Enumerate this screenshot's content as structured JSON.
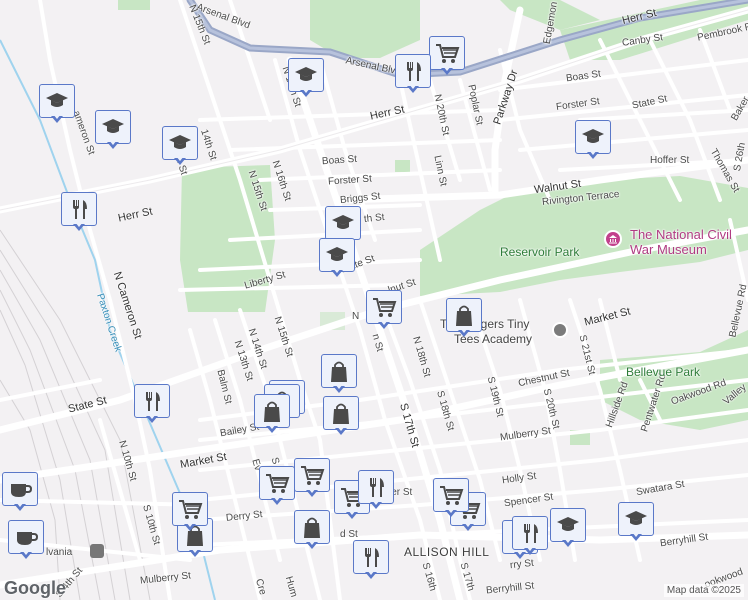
{
  "map": {
    "streets": {
      "arsenal_blvd": "Arsenal Blvd",
      "herr_st_top": "Herr St",
      "herr_st_mid": "Herr St",
      "herr_st_left": "Herr St",
      "canby_st": "Canby St",
      "pembrook_rd": "Pembrook R",
      "boas_st_right": "Boas St",
      "boas_st_left": "Boas St",
      "forster_st_right": "Forster St",
      "forster_st_left": "Forster St",
      "state_st_right": "State St",
      "state_st_mid": "State St",
      "state_st_left": "State St",
      "baker": "Baker",
      "hoffer_st": "Hoffer St",
      "thomas_st": "Thomas St",
      "s_26th": "S 26th",
      "walnut_st": "Walnut St",
      "rivington_terrace": "Rivington Terrace",
      "briggs_st": "Briggs St",
      "nth_st": "th St",
      "liberty_st": "Liberty St",
      "lnut_st": "lnut St",
      "market_st_right": "Market St",
      "market_st_left": "Market St",
      "chestnut_st": "Chestnut St",
      "mulberry_st": "Mulberry St",
      "mulberry_st_bottom": "Mulberry St",
      "holly_st": "Holly St",
      "spencer_st": "Spencer St",
      "swatara_st": "Swatara St",
      "berryhill_st_right": "Berryhill St",
      "berryhill_st_left": "Berryhill St",
      "derry_st": "Derry St",
      "derry_st_2": "Derry St",
      "bailey_st": "Bailey St",
      "n_15th_top": "N 15th St",
      "n_17th_top": "N 17th St",
      "n_14th": "14th St",
      "n_13th_top": "th St",
      "n_16th": "N 16th St",
      "n_15th_mid": "N 15th St",
      "n_20th": "N 20th St",
      "linn_st": "Linn St",
      "poplar_st": "Poplar St",
      "parkway_dr": "Parkway Dr",
      "edgemont": "Edgemon",
      "cameron_top": "ameron St",
      "n_cameron": "N Cameron St",
      "n_10th": "N 10th St",
      "s_10th": "S 10th St",
      "n_13th": "N 13th St",
      "n_14th_b": "N 14th St",
      "n_15th_b": "N 15th St",
      "n_18th": "N 18th St",
      "s_17th": "S 17th St",
      "s_18th": "S 18th St",
      "s_19th": "S 19th St",
      "s_20th": "S 20th St",
      "s_21st": "S 21st St",
      "hillside": "Hillside Rd",
      "pentwater": "Pentwater Rd",
      "oakwood": "Oakwood Rd",
      "bellevue_rd": "Bellevue Rd",
      "valley": "Valley",
      "balm_st": "Balm St",
      "s_4th": "S 4th St",
      "s_16th": "S 16th",
      "s_17th_b": "S 17th",
      "humb": "Hum",
      "cre": "Cre",
      "everb": "Ev",
      "s1": "S 1",
      "dst": "d St",
      "nm_st": "N",
      "n_st2": "n St",
      "lower_st": "wer St",
      "arry_st": "rry St",
      "arry2": "Derry St",
      "oakwood_bottom": "ookwood",
      "d_st": "D"
    },
    "places": {
      "reservoir_park": "Reservoir Park",
      "national_museum_1": "The National Civil",
      "national_museum_2": "War Museum",
      "tiny_tees_1": "The Fingers Tiny",
      "tiny_tees_2": "Tees Academy",
      "bellevue_park": "Bellevue Park",
      "allison_hill": "ALLISON HILL",
      "paxton_creek": "Paxton Creek",
      "pennsylvania": "lvania",
      "google": "Google",
      "map_data": "Map data ©2025"
    },
    "colors": {
      "background": "#f3f1f3",
      "park": "#c8e6c4",
      "highway": "#9aa7c7",
      "pin_border": "#5a78c8",
      "pin_fill": "#eef2fb",
      "museum": "#c2408c",
      "water": "#9fd3ee"
    },
    "pins": [
      {
        "icon": "school-icon"
      },
      {
        "icon": "school-icon"
      },
      {
        "icon": "school-icon"
      },
      {
        "icon": "school-icon"
      },
      {
        "icon": "restaurant-icon"
      },
      {
        "icon": "cart-icon"
      },
      {
        "icon": "school-icon"
      },
      {
        "icon": "restaurant-icon"
      },
      {
        "icon": "school-icon"
      },
      {
        "icon": "school-icon"
      },
      {
        "icon": "cart-icon"
      },
      {
        "icon": "shopping-bag-icon"
      },
      {
        "icon": "shopping-bag-icon"
      },
      {
        "icon": "restaurant-icon"
      },
      {
        "icon": "shopping-bag-icon"
      },
      {
        "icon": "shopping-bag-icon"
      },
      {
        "icon": "shopping-bag-icon"
      },
      {
        "icon": "cart-icon"
      },
      {
        "icon": "cart-icon"
      },
      {
        "icon": "cart-icon"
      },
      {
        "icon": "restaurant-icon"
      },
      {
        "icon": "cart-icon"
      },
      {
        "icon": "shopping-bag-icon"
      },
      {
        "icon": "shopping-bag-icon"
      },
      {
        "icon": "restaurant-icon"
      },
      {
        "icon": "coffee-icon"
      },
      {
        "icon": "coffee-icon"
      },
      {
        "icon": "cart-icon"
      },
      {
        "icon": "restaurant-icon"
      },
      {
        "icon": "cart-icon"
      },
      {
        "icon": "restaurant-icon"
      },
      {
        "icon": "school-icon"
      },
      {
        "icon": "school-icon"
      },
      {
        "icon": "shopping-bag-icon"
      }
    ]
  }
}
